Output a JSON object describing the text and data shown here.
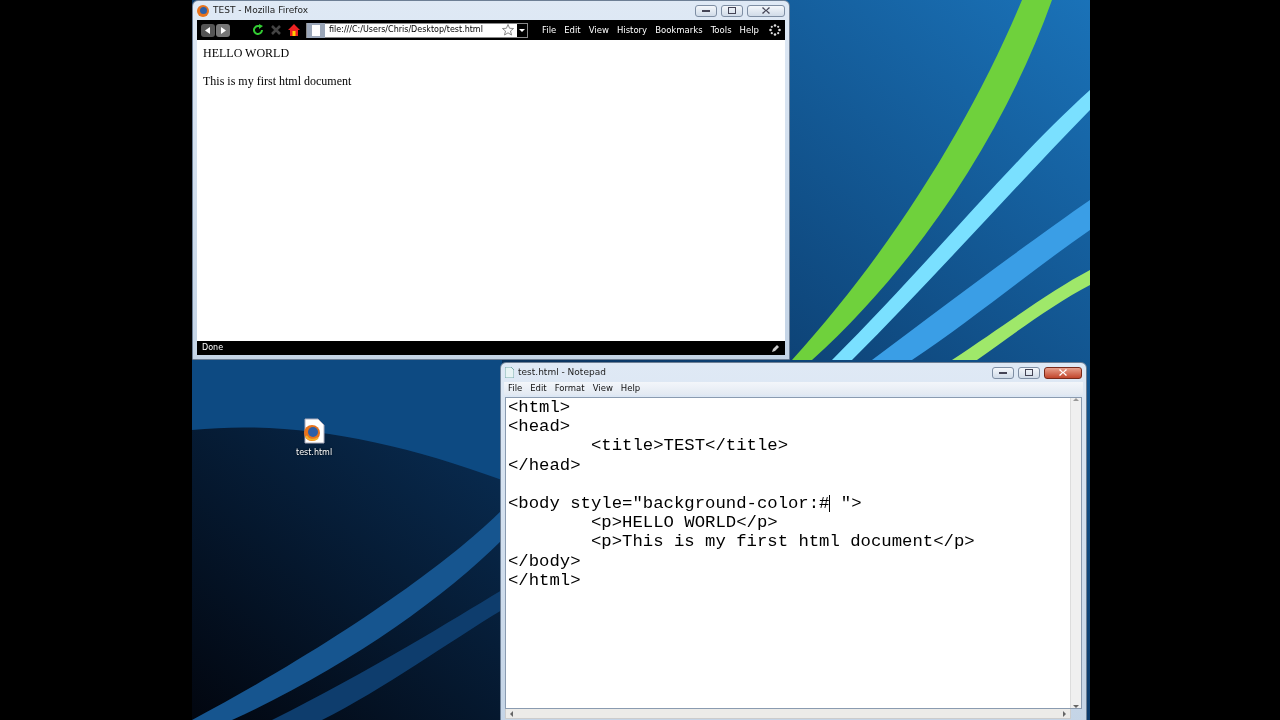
{
  "browser": {
    "title": "TEST - Mozilla Firefox",
    "url": "file:///C:/Users/Chris/Desktop/test.html",
    "menu": [
      "File",
      "Edit",
      "View",
      "History",
      "Bookmarks",
      "Tools",
      "Help"
    ],
    "page": [
      "HELLO WORLD",
      "This is my first html document"
    ],
    "status": "Done"
  },
  "notepad": {
    "title": "test.html - Notepad",
    "menu": [
      "File",
      "Edit",
      "Format",
      "View",
      "Help"
    ],
    "lines": [
      {
        "kind": "code",
        "text": "<html>"
      },
      {
        "kind": "code",
        "text": "<head>"
      },
      {
        "kind": "code",
        "text": "\t<title>TEST</title>"
      },
      {
        "kind": "code",
        "text": "</head>"
      },
      {
        "kind": "blank"
      },
      {
        "kind": "code",
        "text": "<body style=\"background-color:#",
        "cursor": true,
        "text_after_cursor": " \">"
      },
      {
        "kind": "code",
        "text": "\t<p>HELLO WORLD</p>"
      },
      {
        "kind": "code",
        "text": "\t<p>This is my first html document</p>"
      },
      {
        "kind": "code",
        "text": "</body>"
      },
      {
        "kind": "code",
        "text": "</html>"
      }
    ]
  },
  "desktop_icons": [
    {
      "label": "test.html"
    }
  ]
}
